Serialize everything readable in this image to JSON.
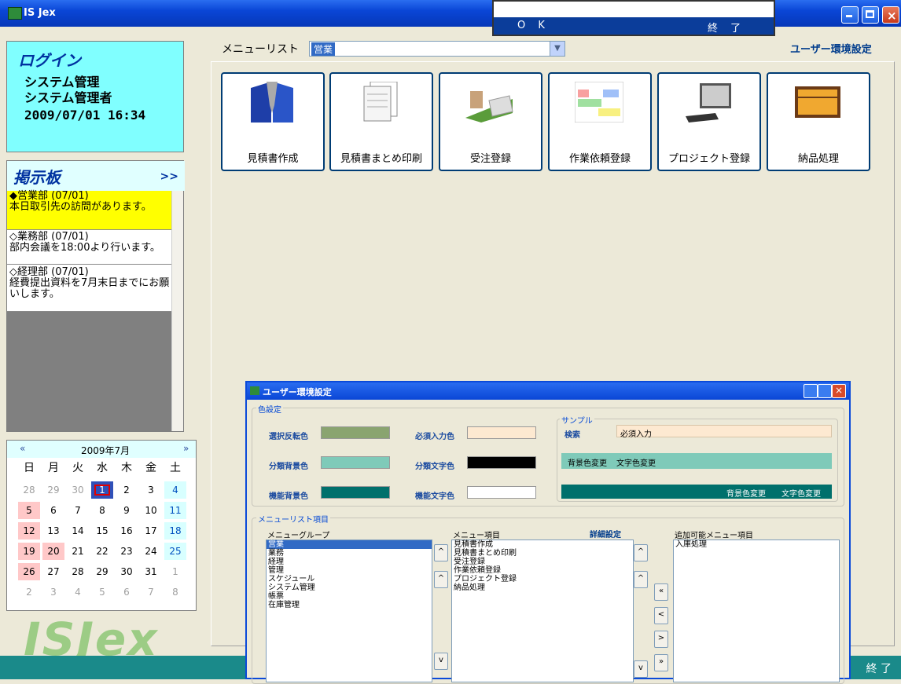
{
  "window": {
    "title": "IS Jex"
  },
  "top_dialog": {
    "ok": "O K",
    "exit": "終 了"
  },
  "login": {
    "title": "ログイン",
    "line1": "システム管理",
    "line2": "システム管理者",
    "datetime": "2009/07/01 16:34"
  },
  "board": {
    "title": "掲示板",
    "more": ">>",
    "posts": [
      {
        "head": "◆営業部 (07/01)",
        "body": "本日取引先の訪問があります。"
      },
      {
        "head": "◇業務部 (07/01)",
        "body": "部内会議を18:00より行います。"
      },
      {
        "head": "◇経理部 (07/01)",
        "body": "経費提出資料を7月末日までにお願いします。"
      }
    ]
  },
  "calendar": {
    "prev": "«",
    "month": "2009年7月",
    "next": "»",
    "weekdays": [
      "日",
      "月",
      "火",
      "水",
      "木",
      "金",
      "土"
    ],
    "weeks": [
      [
        "28",
        "29",
        "30",
        "1",
        "2",
        "3",
        "4"
      ],
      [
        "5",
        "6",
        "7",
        "8",
        "9",
        "10",
        "11"
      ],
      [
        "12",
        "13",
        "14",
        "15",
        "16",
        "17",
        "18"
      ],
      [
        "19",
        "20",
        "21",
        "22",
        "23",
        "24",
        "25"
      ],
      [
        "26",
        "27",
        "28",
        "29",
        "30",
        "31",
        "1"
      ],
      [
        "2",
        "3",
        "4",
        "5",
        "6",
        "7",
        "8"
      ]
    ]
  },
  "logo": "ISJex",
  "menubar": {
    "label": "メニューリスト",
    "selected": "営業",
    "user_settings": "ユーザー環境設定"
  },
  "tiles": [
    "見積書作成",
    "見積書まとめ印刷",
    "受注登録",
    "作業依頼登録",
    "プロジェクト登録",
    "納品処理"
  ],
  "statusbar": {
    "exit": "終 了"
  },
  "env_dialog": {
    "title": "ユーザー環境設定",
    "color_group": "色設定",
    "labels": {
      "select_reverse": "選択反転色",
      "required_input": "必須入力色",
      "category_bg": "分類背景色",
      "category_text": "分類文字色",
      "function_bg": "機能背景色",
      "function_text": "機能文字色"
    },
    "sample": {
      "group": "サンプル",
      "search": "検索",
      "required": "必須入力",
      "bg_change": "背景色変更",
      "text_change": "文字色変更"
    },
    "colors": {
      "select_reverse": "#8aa470",
      "required_input": "#fde9d1",
      "category_bg": "#7fcab9",
      "category_text": "#000000",
      "function_bg": "#00706c",
      "function_text": "#ffffff"
    },
    "menu_group": "メニューリスト項目",
    "group_label": "メニューグループ",
    "groups": [
      "営業",
      "業務",
      "経理",
      "管理",
      "スケジュール",
      "システム管理",
      "帳票",
      "在庫管理"
    ],
    "items_label": "メニュー項目",
    "detail": "詳細設定",
    "items": [
      "見積書作成",
      "見積書まとめ印刷",
      "受注登録",
      "作業依頼登録",
      "プロジェクト登録",
      "納品処理"
    ],
    "available_label": "追加可能メニュー項目",
    "available": [
      "入庫処理"
    ]
  }
}
